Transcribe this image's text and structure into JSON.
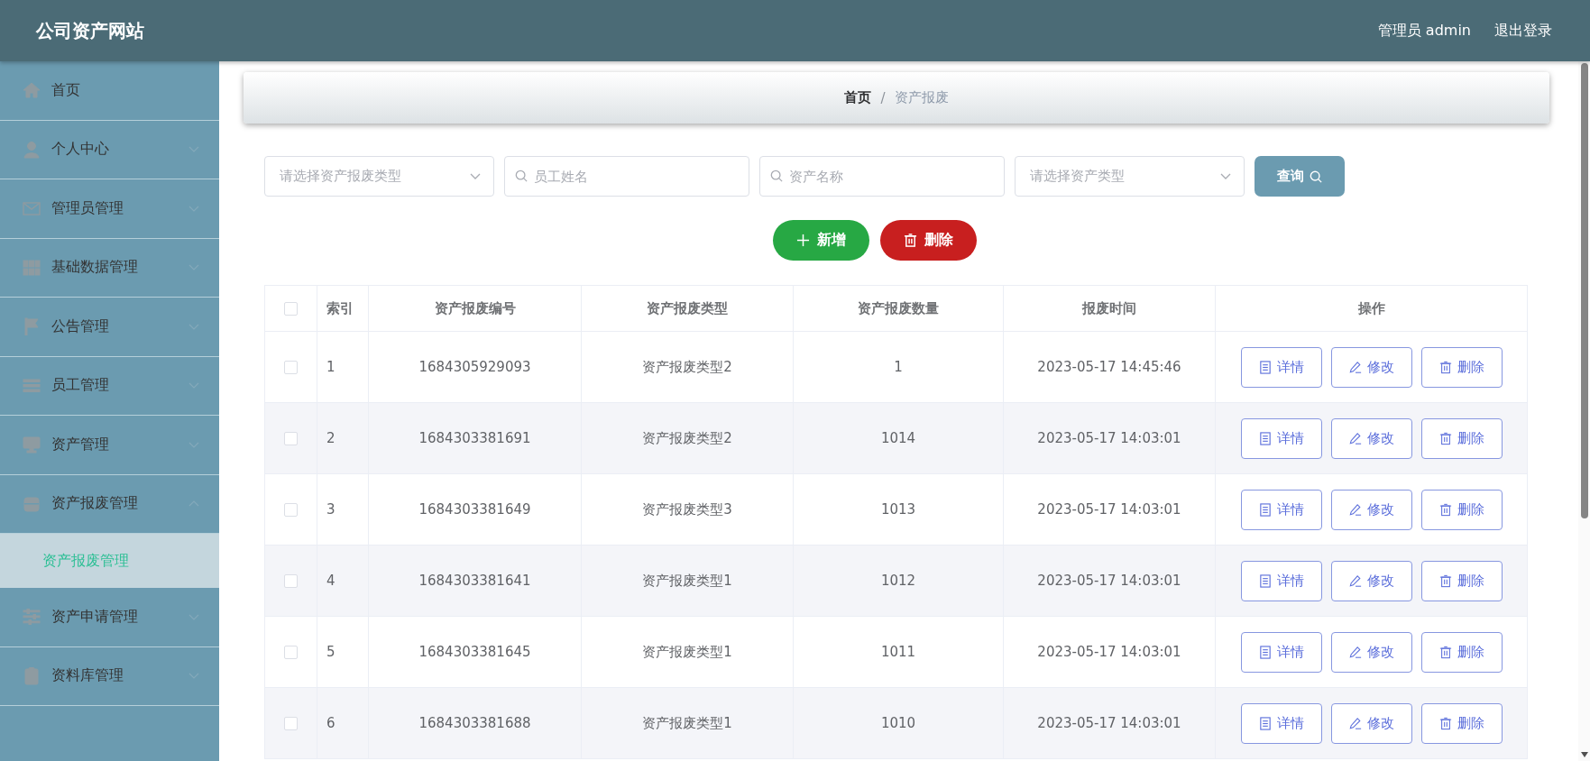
{
  "header": {
    "title": "公司资产网站",
    "user": "管理员 admin",
    "logout": "退出登录"
  },
  "sidebar": {
    "items": [
      {
        "label": "首页",
        "kind": "link",
        "selected": false
      },
      {
        "label": "个人中心",
        "kind": "menu",
        "selected": false,
        "expanded": false
      },
      {
        "label": "管理员管理",
        "kind": "menu",
        "selected": false,
        "expanded": false
      },
      {
        "label": "基础数据管理",
        "kind": "menu",
        "selected": false,
        "expanded": false
      },
      {
        "label": "公告管理",
        "kind": "menu",
        "selected": false,
        "expanded": false
      },
      {
        "label": "员工管理",
        "kind": "menu",
        "selected": false,
        "expanded": false
      },
      {
        "label": "资产管理",
        "kind": "menu",
        "selected": false,
        "expanded": false
      },
      {
        "label": "资产报废管理",
        "kind": "menu",
        "selected": false,
        "expanded": true,
        "children": [
          {
            "label": "资产报废管理",
            "selected": true
          }
        ]
      },
      {
        "label": "资产申请管理",
        "kind": "menu",
        "selected": false,
        "expanded": false
      },
      {
        "label": "资料库管理",
        "kind": "menu",
        "selected": false,
        "expanded": false
      }
    ]
  },
  "breadcrumb": {
    "separator": "/",
    "items": [
      {
        "label": "首页",
        "current": false
      },
      {
        "label": "资产报废",
        "current": true
      }
    ]
  },
  "filters": [
    {
      "kind": "select",
      "placeholder": "请选择资产报废类型"
    },
    {
      "kind": "search",
      "placeholder": "员工姓名"
    },
    {
      "kind": "search",
      "placeholder": "资产名称"
    },
    {
      "kind": "select",
      "placeholder": "请选择资产类型"
    }
  ],
  "query_button": "查询",
  "toolbar": [
    {
      "kind": "add",
      "label": "新增"
    },
    {
      "kind": "delete",
      "label": "删除"
    }
  ],
  "table": {
    "select_all_checked": false,
    "columns": [
      "索引",
      "资产报废编号",
      "资产报废类型",
      "资产报废数量",
      "报废时间",
      "操作"
    ],
    "rows": [
      {
        "checked": false,
        "cells": [
          "1",
          "1684305929093",
          "资产报废类型2",
          "1",
          "2023-05-17 14:45:46"
        ],
        "actions": [
          {
            "kind": "detail",
            "label": "详情"
          },
          {
            "kind": "edit",
            "label": "修改"
          },
          {
            "kind": "delete",
            "label": "删除"
          }
        ]
      },
      {
        "checked": false,
        "cells": [
          "2",
          "1684303381691",
          "资产报废类型2",
          "1014",
          "2023-05-17 14:03:01"
        ],
        "actions": [
          {
            "kind": "detail",
            "label": "详情"
          },
          {
            "kind": "edit",
            "label": "修改"
          },
          {
            "kind": "delete",
            "label": "删除"
          }
        ]
      },
      {
        "checked": false,
        "cells": [
          "3",
          "1684303381649",
          "资产报废类型3",
          "1013",
          "2023-05-17 14:03:01"
        ],
        "actions": [
          {
            "kind": "detail",
            "label": "详情"
          },
          {
            "kind": "edit",
            "label": "修改"
          },
          {
            "kind": "delete",
            "label": "删除"
          }
        ]
      },
      {
        "checked": false,
        "cells": [
          "4",
          "1684303381641",
          "资产报废类型1",
          "1012",
          "2023-05-17 14:03:01"
        ],
        "actions": [
          {
            "kind": "detail",
            "label": "详情"
          },
          {
            "kind": "edit",
            "label": "修改"
          },
          {
            "kind": "delete",
            "label": "删除"
          }
        ]
      },
      {
        "checked": false,
        "cells": [
          "5",
          "1684303381645",
          "资产报废类型1",
          "1011",
          "2023-05-17 14:03:01"
        ],
        "actions": [
          {
            "kind": "detail",
            "label": "详情"
          },
          {
            "kind": "edit",
            "label": "修改"
          },
          {
            "kind": "delete",
            "label": "删除"
          }
        ]
      },
      {
        "checked": false,
        "cells": [
          "6",
          "1684303381688",
          "资产报废类型1",
          "1010",
          "2023-05-17 14:03:01"
        ],
        "actions": [
          {
            "kind": "detail",
            "label": "详情"
          },
          {
            "kind": "edit",
            "label": "修改"
          },
          {
            "kind": "delete",
            "label": "删除"
          }
        ]
      }
    ]
  }
}
